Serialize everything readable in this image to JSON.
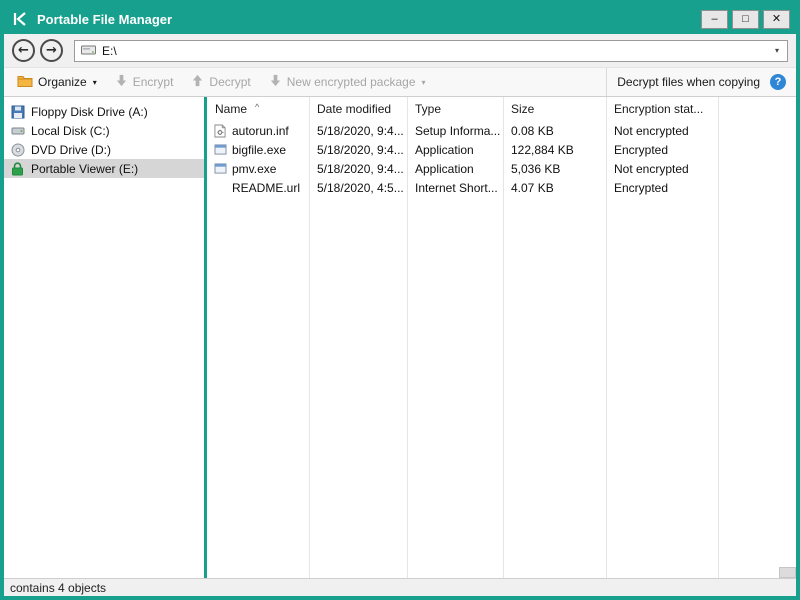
{
  "colors": {
    "accent_teal": "#17A08D",
    "help_blue": "#2F86D6",
    "folder_yellow": "#F4B542",
    "lock_green": "#2EA04C",
    "selection_gray": "#D6D6D6"
  },
  "window": {
    "title": "Portable File Manager",
    "minimize_label": "–",
    "maximize_label": "□",
    "close_label": "✕"
  },
  "navigation": {
    "back_icon": "←",
    "forward_icon": "→",
    "address": "E:\\",
    "dropdown_icon": "▾"
  },
  "toolbar": {
    "organize_label": "Organize",
    "organize_caret": "▾",
    "encrypt_label": "Encrypt",
    "decrypt_label": "Decrypt",
    "new_package_label": "New encrypted package",
    "new_package_caret": "▾",
    "decrypt_when_copying_label": "Decrypt files when copying",
    "help_icon": "?"
  },
  "sidebar": {
    "items": [
      {
        "label": "Floppy Disk Drive (A:)",
        "icon": "floppy-disk-icon",
        "selected": false
      },
      {
        "label": "Local Disk (C:)",
        "icon": "hard-disk-icon",
        "selected": false
      },
      {
        "label": "DVD Drive (D:)",
        "icon": "dvd-disc-icon",
        "selected": false
      },
      {
        "label": "Portable Viewer (E:)",
        "icon": "lock-icon",
        "selected": true
      }
    ]
  },
  "filelist": {
    "columns": [
      "Name",
      "Date modified",
      "Type",
      "Size",
      "Encryption stat..."
    ],
    "sort_indicator": "^",
    "rows": [
      {
        "name": "autorun.inf",
        "date": "5/18/2020, 9:4...",
        "type": "Setup Informa...",
        "size": "0.08 KB",
        "encryption": "Not encrypted",
        "icon": "setup-file-icon"
      },
      {
        "name": "bigfile.exe",
        "date": "5/18/2020, 9:4...",
        "type": "Application",
        "size": "122,884 KB",
        "encryption": "Encrypted",
        "icon": "application-icon"
      },
      {
        "name": "pmv.exe",
        "date": "5/18/2020, 9:4...",
        "type": "Application",
        "size": "5,036 KB",
        "encryption": "Not encrypted",
        "icon": "application-icon"
      },
      {
        "name": "README.url",
        "date": "5/18/2020, 4:5...",
        "type": "Internet Short...",
        "size": "4.07 KB",
        "encryption": "Encrypted",
        "icon": "none"
      }
    ]
  },
  "statusbar": {
    "text": "contains 4 objects"
  }
}
